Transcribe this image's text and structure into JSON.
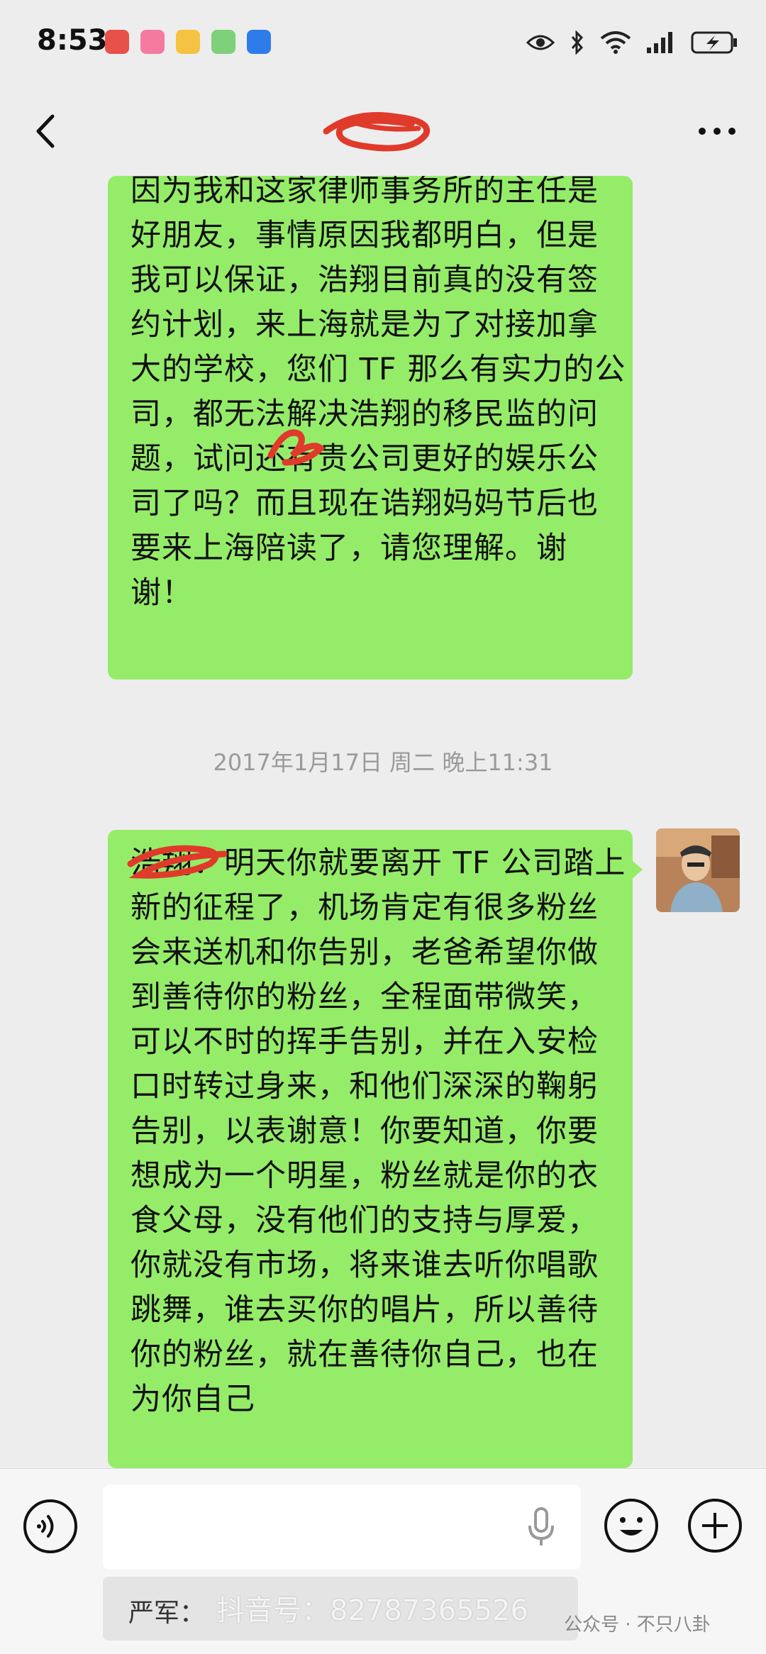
{
  "status_bar": {
    "time": "8:53"
  },
  "nav": {
    "title": ""
  },
  "messages": [
    {
      "text": "因为我和这家律师事务所的主任是好朋友，事情原因我都明白，但是我可以保证，浩翔目前真的没有签约计划，来上海就是为了对接加拿大的学校，您们 TF 那么有实力的公司，都无法解决浩翔的移民监的问题，试问还有贵公司更好的娱乐公司了吗？而且现在诰翔妈妈节后也要来上海陪读了，请您理解。谢谢！"
    },
    {
      "text": "浩翔：明天你就要离开 TF 公司踏上新的征程了，机场肯定有很多粉丝会来送机和你告别，老爸希望你做到善待你的粉丝，全程面带微笑，可以不时的挥手告别，并在入安检口时转过身来，和他们深深的鞠躬告别，以表谢意！你要知道，你要想成为一个明星，粉丝就是你的衣食父母，没有他们的支持与厚爱，你就没有市场，将来谁去听你唱歌跳舞，谁去买你的唱片，所以善待你的粉丝，就在善待你自己，也在为你自己"
    }
  ],
  "timestamp": "2017年1月17日 周二 晚上11:31",
  "input": {
    "value": "",
    "quote_text": "严军："
  },
  "watermark": {
    "text": "抖音号：82787365526",
    "source": "公众号 · 不只八卦"
  },
  "colors": {
    "bubble": "#95ec69",
    "background": "#ededed"
  }
}
